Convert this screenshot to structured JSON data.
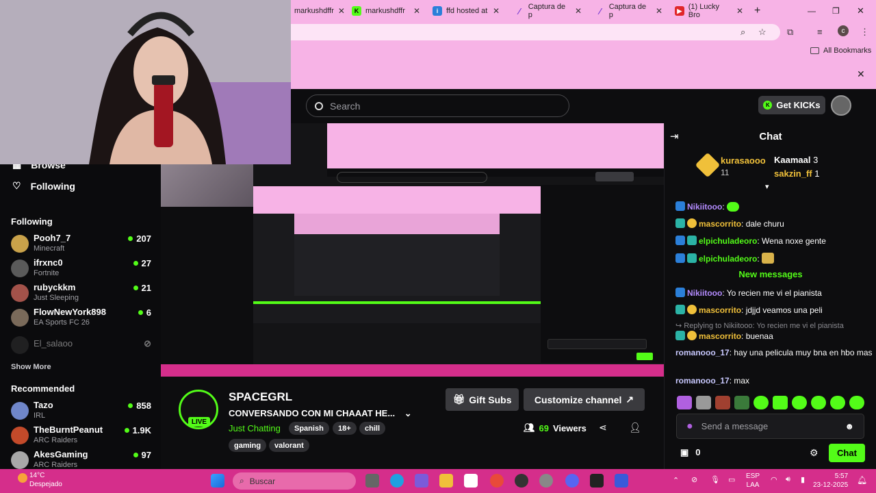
{
  "browser": {
    "tabs": [
      {
        "label": "markushdffr",
        "icon": "kick-icon"
      },
      {
        "label": "markushdffr",
        "icon": "kick-icon"
      },
      {
        "label": "ffd hosted at",
        "icon": "ibb-icon"
      },
      {
        "label": "Captura de p",
        "icon": "pen-icon"
      },
      {
        "label": "Captura de p",
        "icon": "pen-icon"
      },
      {
        "label": "(1) Lucky Bro",
        "icon": "youtube-icon"
      }
    ],
    "all_bookmarks": "All Bookmarks",
    "profile_initial": "c"
  },
  "header": {
    "search_placeholder": "Search",
    "get_kicks": "Get KICKs"
  },
  "sidebar": {
    "browse": "Browse",
    "following_nav": "Following",
    "following_title": "Following",
    "following": [
      {
        "name": "Pooh7_7",
        "game": "Minecraft",
        "viewers": "207",
        "color": "#c9a24a"
      },
      {
        "name": "ifrxnc0",
        "game": "Fortnite",
        "viewers": "27",
        "color": "#5a5a5a"
      },
      {
        "name": "rubyckkm",
        "game": "Just Sleeping",
        "viewers": "21",
        "color": "#a3524a"
      },
      {
        "name": "FlowNewYork898",
        "game": "EA Sports FC 26",
        "viewers": "6",
        "color": "#7a6a5a"
      },
      {
        "name": "El_salaoo",
        "game": "",
        "viewers": "",
        "color": "#3a3a3a"
      }
    ],
    "show_more": "Show More",
    "recommended_title": "Recommended",
    "recommended": [
      {
        "name": "Tazo",
        "game": "IRL",
        "viewers": "858",
        "color": "#6f86c9"
      },
      {
        "name": "TheBurntPeanut",
        "game": "ARC Raiders",
        "viewers": "1.9K",
        "color": "#c34a2a"
      },
      {
        "name": "AkesGaming",
        "game": "ARC Raiders",
        "viewers": "97",
        "color": "#a8a8a8"
      }
    ]
  },
  "stream": {
    "channel": "SPACEGRL",
    "live": "LIVE",
    "title": "CONVERSANDO CON MI CHAAAT HE...",
    "category": "Just Chatting",
    "tags": [
      "Spanish",
      "18+",
      "chill",
      "gaming",
      "valorant"
    ],
    "gift_subs": "Gift Subs",
    "customize": "Customize channel",
    "viewer_count": "69",
    "viewers_label": "Viewers"
  },
  "chat": {
    "title": "Chat",
    "top_gifters": [
      {
        "name": "kurasaooo",
        "count": "11"
      },
      {
        "name": "Kaamaal",
        "count": "3"
      },
      {
        "name": "sakzin_ff",
        "count": "1"
      }
    ],
    "messages": [
      {
        "user": "Nikiitooo",
        "text": "",
        "color": "#b48cff"
      },
      {
        "user": "mascorrito",
        "text": "dale churu",
        "color": "#f0c03a"
      },
      {
        "user": "elpichuladeoro",
        "text": "Wena noxe gente",
        "color": "#53fc18"
      },
      {
        "user": "elpichuladeoro",
        "text": "",
        "color": "#53fc18"
      }
    ],
    "new_messages": "New messages",
    "messages2": [
      {
        "user": "Nikiitooo",
        "text": "Yo recien me vi el pianista",
        "color": "#b48cff"
      },
      {
        "user": "mascorrito",
        "text": "jdjjd veamos una peli",
        "color": "#f0c03a"
      }
    ],
    "reply_note": "Replying to Nikiitooo: Yo recien me vi el pianista",
    "messages3": [
      {
        "user": "mascorrito",
        "text": "buenaa",
        "color": "#f0c03a"
      },
      {
        "user": "romanooo_17",
        "text": "hay una pelicula muy bna en hbo mas",
        "color": "#c9c9ff"
      },
      {
        "user": "romanooo_17",
        "text": "max",
        "color": "#c9c9ff"
      }
    ],
    "input_placeholder": "Send a message",
    "kicks_count": "0",
    "chat_button": "Chat"
  },
  "taskbar": {
    "temp": "14°C",
    "weather": "Despejado",
    "search": "Buscar",
    "lang1": "ESP",
    "lang2": "LAA",
    "time": "5:57",
    "date": "23-12-2025"
  },
  "colors": {
    "kick_green": "#53fc18",
    "chrome_pink": "#f7b3e6",
    "taskbar_pink": "#d52e8b"
  }
}
